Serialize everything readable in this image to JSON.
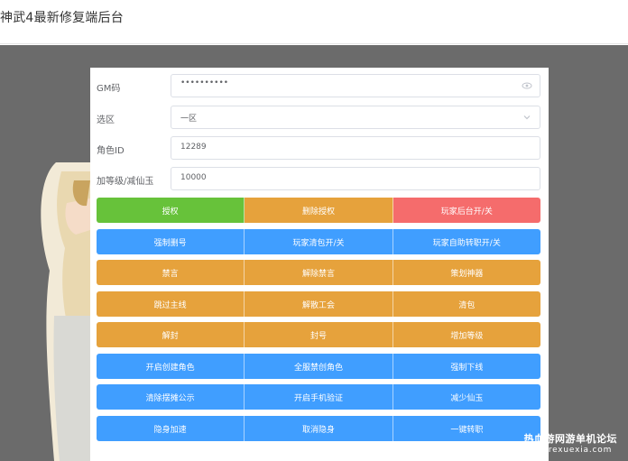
{
  "page": {
    "title": "神武4最新修复端后台"
  },
  "form": {
    "gm_code": {
      "label": "GM码",
      "value": "••••••••••"
    },
    "zone": {
      "label": "选区",
      "value": "一区"
    },
    "role_id": {
      "label": "角色ID",
      "value": "12289"
    },
    "level_jade": {
      "label": "加等级/减仙玉",
      "value": "10000"
    }
  },
  "button_rows": [
    {
      "buttons": [
        {
          "label": "授权",
          "color": "#67c23a"
        },
        {
          "label": "删除授权",
          "color": "#e6a23c"
        },
        {
          "label": "玩家后台开/关",
          "color": "#f56c6c"
        }
      ]
    },
    {
      "buttons": [
        {
          "label": "强制删号",
          "color": "#409eff"
        },
        {
          "label": "玩家清包开/关",
          "color": "#409eff"
        },
        {
          "label": "玩家自助转职开/关",
          "color": "#409eff"
        }
      ]
    },
    {
      "buttons": [
        {
          "label": "禁言",
          "color": "#e6a23c"
        },
        {
          "label": "解除禁言",
          "color": "#e6a23c"
        },
        {
          "label": "策划神器",
          "color": "#e6a23c"
        }
      ]
    },
    {
      "buttons": [
        {
          "label": "跳过主线",
          "color": "#e6a23c"
        },
        {
          "label": "解散工会",
          "color": "#e6a23c"
        },
        {
          "label": "清包",
          "color": "#e6a23c"
        }
      ]
    },
    {
      "buttons": [
        {
          "label": "解封",
          "color": "#e6a23c"
        },
        {
          "label": "封号",
          "color": "#e6a23c"
        },
        {
          "label": "增加等级",
          "color": "#e6a23c"
        }
      ]
    },
    {
      "buttons": [
        {
          "label": "开启创建角色",
          "color": "#409eff"
        },
        {
          "label": "全服禁创角色",
          "color": "#409eff"
        },
        {
          "label": "强制下线",
          "color": "#409eff"
        }
      ]
    },
    {
      "buttons": [
        {
          "label": "清除摆摊公示",
          "color": "#409eff"
        },
        {
          "label": "开启手机验证",
          "color": "#409eff"
        },
        {
          "label": "减少仙玉",
          "color": "#409eff"
        }
      ]
    },
    {
      "buttons": [
        {
          "label": "隐身加速",
          "color": "#409eff"
        },
        {
          "label": "取消隐身",
          "color": "#409eff"
        },
        {
          "label": "一键转职",
          "color": "#409eff"
        }
      ]
    }
  ],
  "watermark": {
    "line1": "热血游网游单机论坛",
    "line2": "www.rexuexia.com"
  }
}
